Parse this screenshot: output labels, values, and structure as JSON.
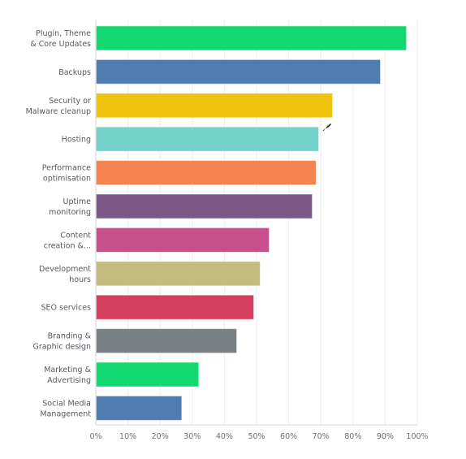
{
  "chart_data": {
    "type": "bar",
    "orientation": "horizontal",
    "title": "",
    "xlabel": "",
    "ylabel": "",
    "xlim": [
      0,
      100
    ],
    "value_format": "percent",
    "grid": true,
    "legend": "none",
    "x_ticks": [
      "0%",
      "10%",
      "20%",
      "30%",
      "40%",
      "50%",
      "60%",
      "70%",
      "80%",
      "90%",
      "100%"
    ],
    "categories": [
      [
        "Plugin, Theme",
        "& Core Updates"
      ],
      [
        "Backups"
      ],
      [
        "Security or",
        "Malware cleanup"
      ],
      [
        "Hosting"
      ],
      [
        "Performance",
        "optimisation"
      ],
      [
        "Uptime",
        "monitoring"
      ],
      [
        "Content",
        "creation &..."
      ],
      [
        "Development",
        "hours"
      ],
      [
        "SEO services"
      ],
      [
        "Branding &",
        "Graphic design"
      ],
      [
        "Marketing &",
        "Advertising"
      ],
      [
        "Social Media",
        "Management"
      ]
    ],
    "values": [
      96.5,
      88.4,
      73.5,
      69.2,
      68.4,
      67.2,
      53.8,
      51.0,
      49.0,
      43.7,
      31.9,
      26.6
    ],
    "colors": [
      "#12d872",
      "#507cb0",
      "#f0c30c",
      "#72d2c9",
      "#f4834f",
      "#7b5888",
      "#c94f8c",
      "#c6bb7f",
      "#d33f5c",
      "#7a8184",
      "#12d872",
      "#507cb0"
    ]
  }
}
